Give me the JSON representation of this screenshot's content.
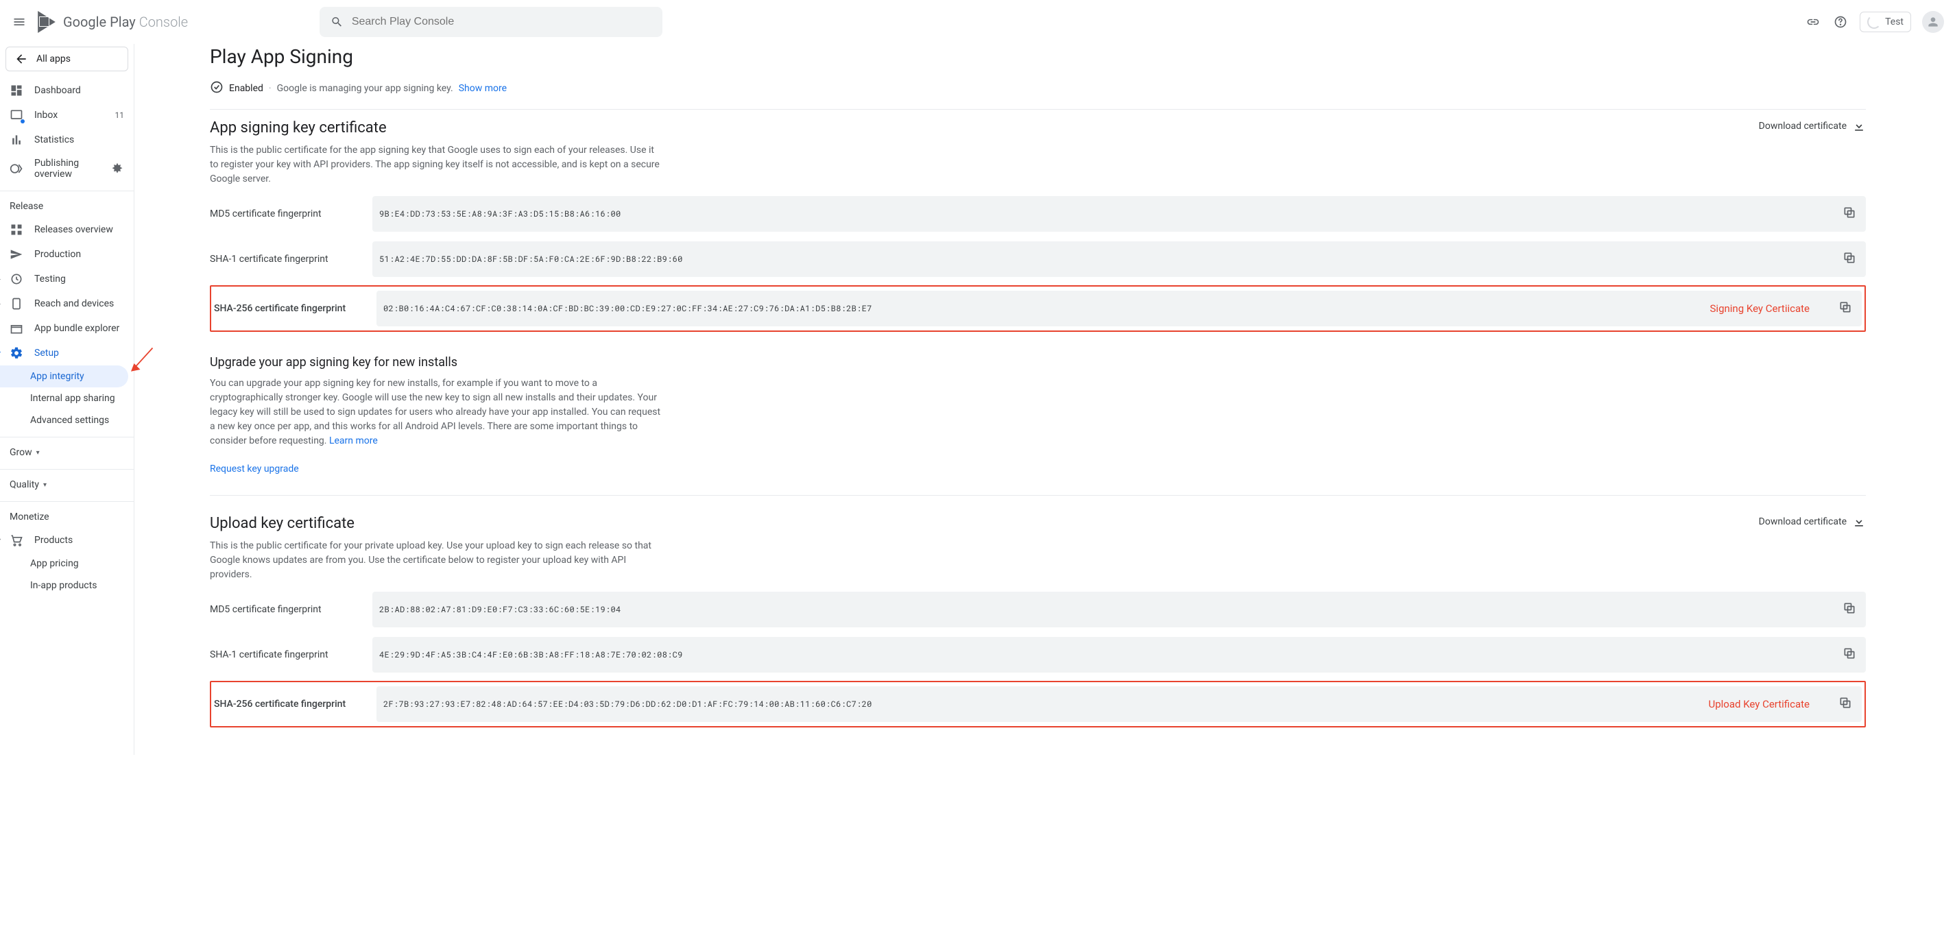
{
  "header": {
    "logo_text_1": "Google Play ",
    "logo_text_2": "Console",
    "search_placeholder": "Search Play Console",
    "test_label": "Test"
  },
  "sidebar": {
    "all_apps": "All apps",
    "items": [
      {
        "label": "Dashboard"
      },
      {
        "label": "Inbox",
        "badge": "11"
      },
      {
        "label": "Statistics"
      },
      {
        "label": "Publishing overview"
      }
    ],
    "release_header": "Release",
    "release_items": [
      {
        "label": "Releases overview"
      },
      {
        "label": "Production"
      },
      {
        "label": "Testing"
      },
      {
        "label": "Reach and devices"
      },
      {
        "label": "App bundle explorer"
      },
      {
        "label": "Setup"
      }
    ],
    "setup_sub": [
      {
        "label": "App integrity"
      },
      {
        "label": "Internal app sharing"
      },
      {
        "label": "Advanced settings"
      }
    ],
    "grow_header": "Grow",
    "quality_header": "Quality",
    "monetize_header": "Monetize",
    "monetize_items": [
      {
        "label": "Products"
      }
    ],
    "monetize_sub": [
      {
        "label": "App pricing"
      },
      {
        "label": "In-app products"
      }
    ]
  },
  "main": {
    "title": "Play App Signing",
    "status_enabled": "Enabled",
    "status_managed": "Google is managing your app signing key.",
    "show_more": "Show more",
    "signing_section": {
      "title": "App signing key certificate",
      "download": "Download certificate",
      "desc": "This is the public certificate for the app signing key that Google uses to sign each of your releases. Use it to register your key with API providers. The app signing key itself is not accessible, and is kept on a secure Google server.",
      "rows": [
        {
          "label": "MD5 certificate fingerprint",
          "value": "9B:E4:DD:73:53:5E:A8:9A:3F:A3:D5:15:B8:A6:16:00"
        },
        {
          "label": "SHA-1 certificate fingerprint",
          "value": "51:A2:4E:7D:55:DD:DA:8F:5B:DF:5A:F0:CA:2E:6F:9D:B8:22:B9:60"
        },
        {
          "label": "SHA-256 certificate fingerprint",
          "value": "02:B0:16:4A:C4:67:CF:C0:38:14:0A:CF:BD:BC:39:00:CD:E9:27:0C:FF:34:AE:27:C9:76:DA:A1:D5:B8:2B:E7"
        }
      ],
      "annotation": "Signing Key Certiicate"
    },
    "upgrade_section": {
      "title": "Upgrade your app signing key for new installs",
      "desc": "You can upgrade your app signing key for new installs, for example if you want to move to a cryptographically stronger key. Google will use the new key to sign all new installs and their updates. Your legacy key will still be used to sign updates for users who already have your app installed. You can request a new key once per app, and this works for all Android API levels. There are some important things to consider before requesting. ",
      "learn_more": "Learn more",
      "request": "Request key upgrade"
    },
    "upload_section": {
      "title": "Upload key certificate",
      "download": "Download certificate",
      "desc": "This is the public certificate for your private upload key. Use your upload key to sign each release so that Google knows updates are from you. Use the certificate below to register your upload key with API providers.",
      "rows": [
        {
          "label": "MD5 certificate fingerprint",
          "value": "2B:AD:88:02:A7:81:D9:E0:F7:C3:33:6C:60:5E:19:04"
        },
        {
          "label": "SHA-1 certificate fingerprint",
          "value": "4E:29:9D:4F:A5:3B:C4:4F:E0:6B:3B:A8:FF:18:A8:7E:70:02:08:C9"
        },
        {
          "label": "SHA-256 certificate fingerprint",
          "value": "2F:7B:93:27:93:E7:82:48:AD:64:57:EE:D4:03:5D:79:D6:DD:62:D0:D1:AF:FC:79:14:00:AB:11:60:C6:C7:20"
        }
      ],
      "annotation": "Upload Key Certificate"
    }
  }
}
